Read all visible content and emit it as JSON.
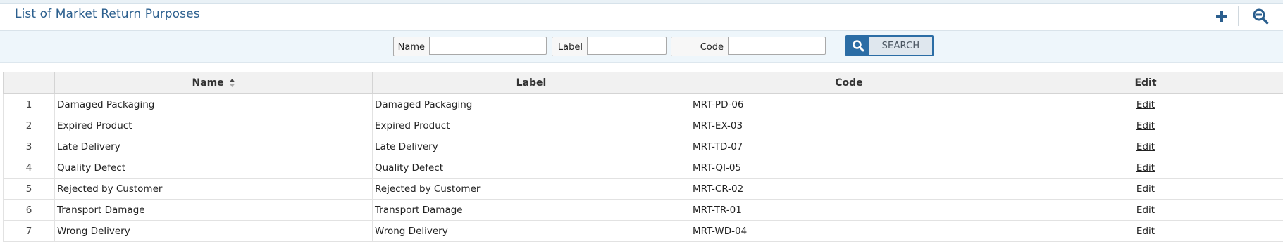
{
  "page": {
    "title": "List of Market Return Purposes",
    "add_icon": "plus-icon",
    "zoom_icon": "zoom-out-icon"
  },
  "filters": {
    "name_label": "Name",
    "name_value": "",
    "label_label": "Label",
    "label_value": "",
    "code_label": "Code",
    "code_value": "",
    "search_label": "SEARCH",
    "search_icon": "search-icon"
  },
  "table": {
    "columns": [
      "",
      "Name",
      "Label",
      "Code",
      "Edit"
    ],
    "sort_column": "Name",
    "rows": [
      {
        "index": "1",
        "name": "Damaged Packaging",
        "label": "Damaged Packaging",
        "code": "MRT-PD-06",
        "edit": "Edit"
      },
      {
        "index": "2",
        "name": "Expired Product",
        "label": "Expired Product",
        "code": "MRT-EX-03",
        "edit": "Edit"
      },
      {
        "index": "3",
        "name": "Late Delivery",
        "label": "Late Delivery",
        "code": "MRT-TD-07",
        "edit": "Edit"
      },
      {
        "index": "4",
        "name": "Quality Defect",
        "label": "Quality Defect",
        "code": "MRT-QI-05",
        "edit": "Edit"
      },
      {
        "index": "5",
        "name": "Rejected by Customer",
        "label": "Rejected by Customer",
        "code": "MRT-CR-02",
        "edit": "Edit"
      },
      {
        "index": "6",
        "name": "Transport Damage",
        "label": "Transport Damage",
        "code": "MRT-TR-01",
        "edit": "Edit"
      },
      {
        "index": "7",
        "name": "Wrong Delivery",
        "label": "Wrong Delivery",
        "code": "MRT-WD-04",
        "edit": "Edit"
      }
    ]
  },
  "colors": {
    "title": "#2b5f8e",
    "accent": "#2b6da5",
    "filter_bg": "#eef6fb",
    "header_bg": "#f1f1f1"
  }
}
